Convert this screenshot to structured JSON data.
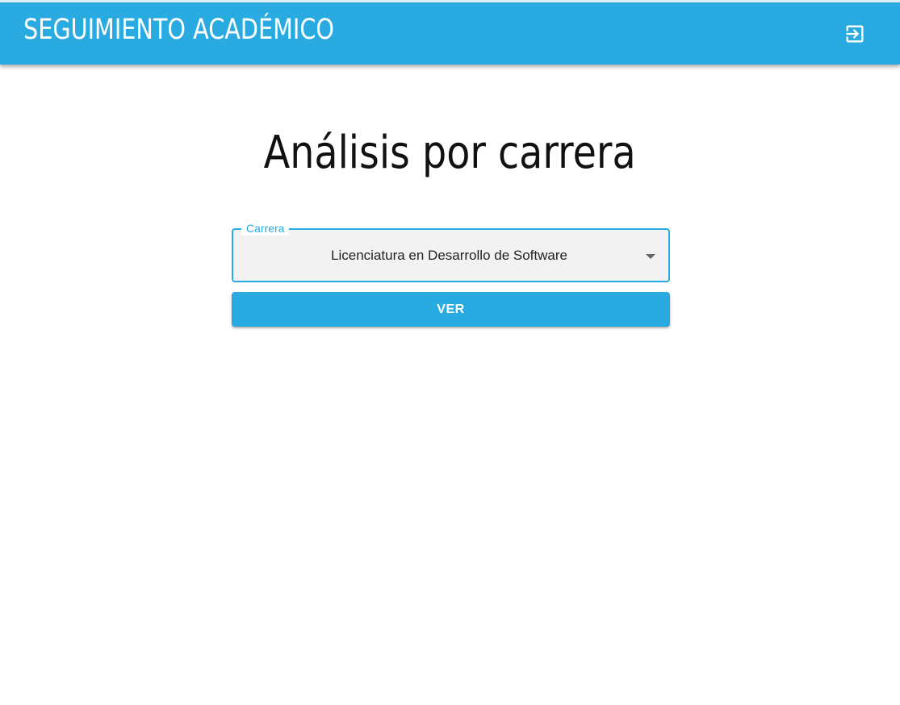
{
  "header": {
    "title": "SEGUIMIENTO ACADÉMICO",
    "logout_icon": "logout-icon",
    "color": "#29abe2"
  },
  "main": {
    "heading": "Análisis por carrera",
    "career_select": {
      "label": "Carrera",
      "value": "Licenciatura en Desarrollo de Software"
    },
    "submit_label": "VER"
  },
  "colors": {
    "accent": "#29abe2",
    "field_background": "#f2f2f2",
    "text": "#222222"
  }
}
